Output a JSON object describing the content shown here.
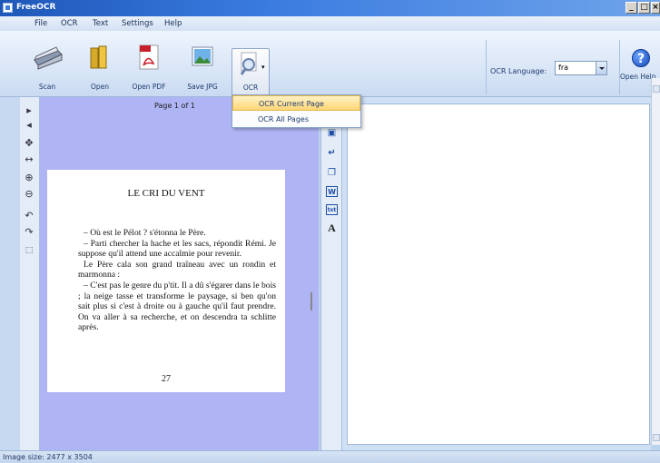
{
  "window": {
    "title": "FreeOCR"
  },
  "menu": [
    "File",
    "OCR",
    "Text",
    "Settings",
    "Help"
  ],
  "toolbar": {
    "scan": "Scan",
    "open": "Open",
    "open_pdf": "Open PDF",
    "save_jpg": "Save JPG",
    "ocr": "OCR",
    "ocr_language_label": "OCR Language:",
    "ocr_language_value": "fra",
    "open_help": "Open Help"
  },
  "ocr_menu": [
    "OCR Current Page",
    "OCR All Pages"
  ],
  "image_panel": {
    "page_label": "Page 1 of 1"
  },
  "document": {
    "title": "LE CRI DU VENT",
    "paragraphs": [
      "– Où est le Pélot ? s'étonna le Père.",
      "– Parti chercher la hache et les sacs, répondit Rémi. Je suppose qu'il attend une accalmie pour revenir.",
      "Le Père cala son grand traîneau avec un rondin et marmonna :",
      "– C'est pas le genre du p'tit. Il a dû s'égarer dans le bois ; la neige tasse et transforme le paysage, si ben qu'on sait plus si c'est à droite ou à gauche qu'il faut prendre. On va aller à sa recherche, et on descendra ta schlitte après."
    ],
    "page_number": "27"
  },
  "status": {
    "image_size": "Image size: 2477 x 3504"
  },
  "icons": [
    "scanner-icon",
    "folder-icon",
    "pdf-icon",
    "image-icon",
    "magnifier-icon",
    "help-icon"
  ]
}
